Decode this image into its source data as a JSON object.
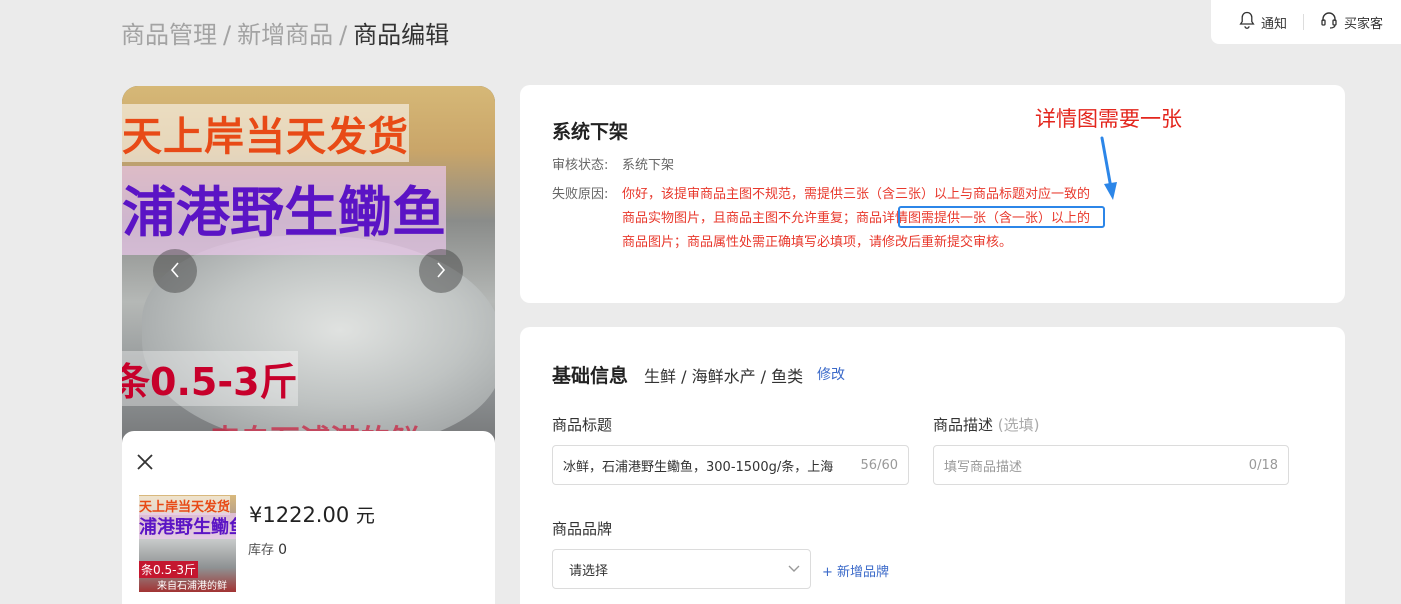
{
  "breadcrumb": {
    "items": [
      "商品管理",
      "新增商品"
    ],
    "separator": "/",
    "current": "商品编辑"
  },
  "topbar": {
    "notify_label": "通知",
    "service_label": "买家客"
  },
  "preview": {
    "hero_text": {
      "line1": "天上岸当天发货",
      "line2": "浦港野生鳓鱼",
      "line3": "条0.5-3斤",
      "line4": "来自石浦港的鲜"
    },
    "price": "¥1222.00",
    "price_unit": "元",
    "stock_label": "库存",
    "stock_value": "0",
    "thumb_text": {
      "line1": "天上岸当天发货",
      "line2": "浦港野生鳓鱼",
      "line3": "条0.5-3斤",
      "line4": "来自石浦港的鲜"
    }
  },
  "status_card": {
    "title": "系统下架",
    "audit_label": "审核状态:",
    "audit_value": "系统下架",
    "reason_label": "失败原因:",
    "reason_text": "你好，该提审商品主图不规范，需提供三张（含三张）以上与商品标题对应一致的商品实物图片，且商品主图不允许重复；商品详情图需提供一张（含一张）以上的商品图片；商品属性处需正确填写必填项，请修改后重新提交审核。"
  },
  "annotation": {
    "text": "详情图需要一张",
    "color": "#e3261d",
    "box_color": "#2c86e8"
  },
  "basic_card": {
    "title": "基础信息",
    "category": "生鲜 / 海鲜水产 / 鱼类",
    "edit_label": "修改",
    "product_title": {
      "label": "商品标题",
      "value": "冰鲜，石浦港野生鳓鱼，300-1500g/条，上海",
      "count": "56/60"
    },
    "product_desc": {
      "label": "商品描述",
      "optional": "(选填)",
      "placeholder": "填写商品描述",
      "count": "0/18"
    },
    "brand": {
      "label": "商品品牌",
      "selected": "请选择",
      "add_label": "+ 新增品牌"
    }
  },
  "colors": {
    "error": "#e8382c",
    "link": "#3a69c9",
    "background": "#ebebeb"
  },
  "icons": [
    "bell-icon",
    "headset-icon",
    "chevron-left-icon",
    "chevron-right-icon",
    "close-icon",
    "chevron-down-icon"
  ]
}
